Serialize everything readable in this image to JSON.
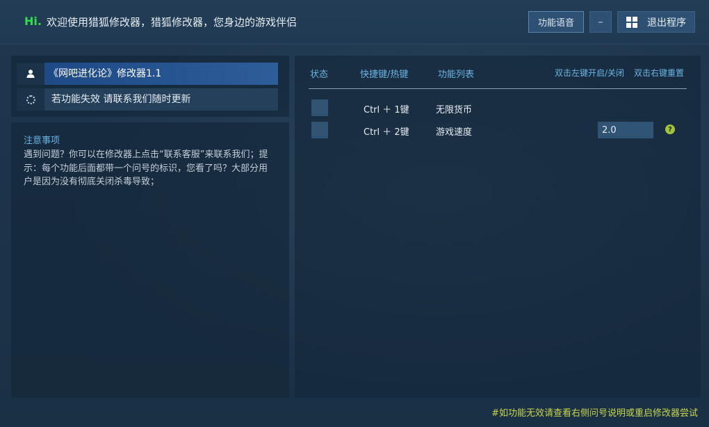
{
  "header": {
    "hi": "Hi.",
    "welcome": "欢迎使用猎狐修改器，猎狐修改器，您身边的游戏伴侣",
    "voice_button": "功能语音",
    "minimize_button": "–",
    "exit_button": "退出程序"
  },
  "left": {
    "trainer_title": "《网吧进化论》修改器1.1",
    "tip_text": "若功能失效 请联系我们随时更新",
    "notes_title": "注意事项",
    "notes_body": "遇到问题？你可以在修改器上点击“联系客服”来联系我们；提示：每个功能后面都带一个问号的标识，您看了吗？大部分用户是因为没有彻底关闭杀毒导致；"
  },
  "table": {
    "headers": {
      "status": "状态",
      "hotkey": "快捷键/热键",
      "features": "功能列表",
      "left_dblclick": "双击左键开启/关闭",
      "right_dblclick": "双击右键重置"
    },
    "rows": [
      {
        "hotkey": "Ctrl ＋ 1键",
        "name": "无限货币"
      },
      {
        "hotkey": "Ctrl ＋ 2键",
        "name": "游戏速度",
        "value": "2.0"
      }
    ]
  },
  "footer_note": "#如功能无效请查看右侧问号说明或重启修改器尝试",
  "colors": {
    "accent_green": "#33e04a",
    "header_blue": "#6ab5e3",
    "footer_yellow": "#c8d64a",
    "selected_row": "#1e4a86"
  },
  "icons": [
    "user-icon",
    "spinner-icon",
    "windows-icon",
    "help-icon"
  ]
}
